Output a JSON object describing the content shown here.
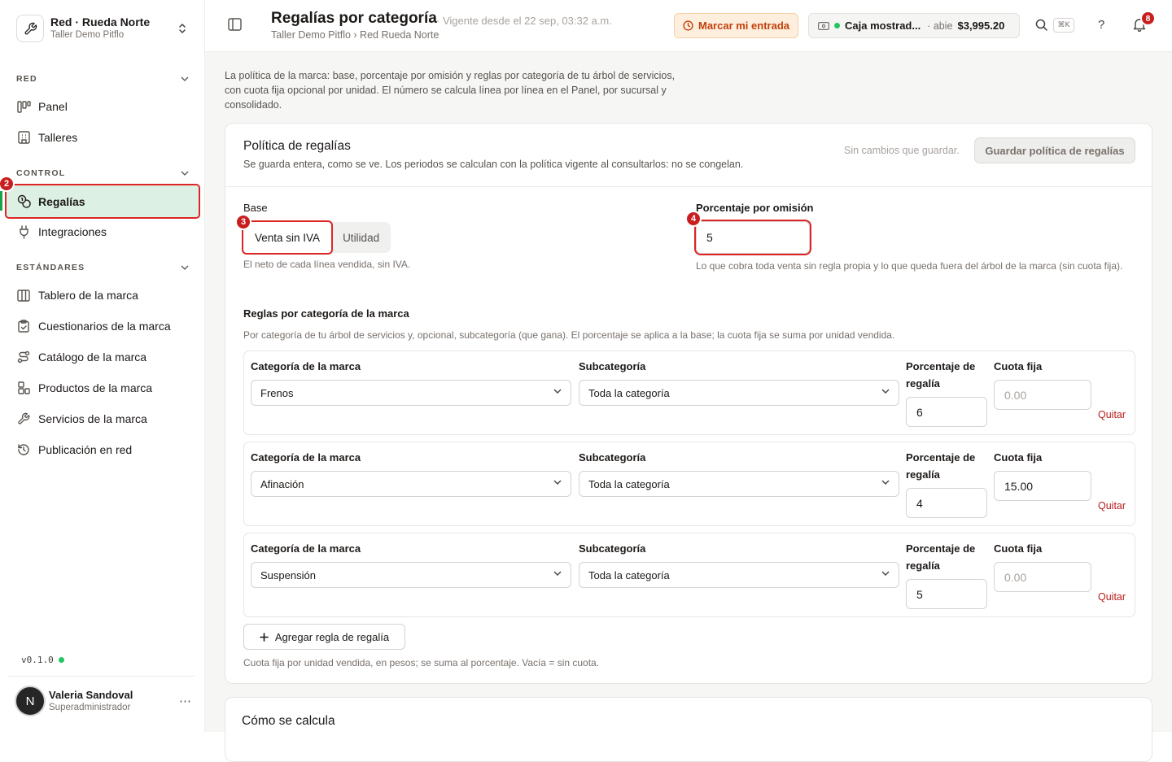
{
  "org": {
    "name": "Red · Rueda Norte",
    "sub": "Taller Demo Pitflo"
  },
  "sidebar": {
    "sections": [
      {
        "title": "RED",
        "items": [
          {
            "label": "Panel"
          },
          {
            "label": "Talleres"
          }
        ]
      },
      {
        "title": "CONTROL",
        "items": [
          {
            "label": "Regalías"
          },
          {
            "label": "Integraciones"
          }
        ]
      },
      {
        "title": "ESTÁNDARES",
        "items": [
          {
            "label": "Tablero de la marca"
          },
          {
            "label": "Cuestionarios de la marca"
          },
          {
            "label": "Catálogo de la marca"
          },
          {
            "label": "Productos de la marca"
          },
          {
            "label": "Servicios de la marca"
          },
          {
            "label": "Publicación en red"
          }
        ]
      }
    ],
    "version": "v0.1.0",
    "user": {
      "initial": "N",
      "name": "Valeria Sandoval",
      "role": "Superadministrador"
    }
  },
  "annotations": {
    "b2": "2",
    "b3": "3",
    "b4": "4"
  },
  "header": {
    "title": "Regalías por categoría",
    "vigencia": "· Vigente desde el 22 sep, 03:32 a.m.",
    "breadcrumb": "Taller Demo Pitflo › Red Rueda Norte",
    "entry_button": "Marcar mi entrada",
    "caja": {
      "name": "Caja mostrad...",
      "status": "· abie",
      "amount": "$3,995.20"
    },
    "kbd": "⌘K",
    "help": "?",
    "notifications": "8"
  },
  "main": {
    "intro": "La política de la marca: base, porcentaje por omisión y reglas por categoría de tu árbol de servicios, con cuota fija opcional por unidad. El número se calcula línea por línea en el Panel, por sucursal y consolidado.",
    "policy": {
      "title": "Política de regalías",
      "subtitle": "Se guarda entera, como se ve. Los periodos se calculan con la política vigente al consultarlos: no se congelan.",
      "no_changes": "Sin cambios que guardar.",
      "save_button": "Guardar política de regalías",
      "base_label": "Base",
      "base_options": [
        "Venta sin IVA",
        "Utilidad"
      ],
      "base_selected": "Venta sin IVA",
      "base_hint": "El neto de cada línea vendida, sin IVA.",
      "default_label": "Porcentaje por omisión",
      "default_value": "5",
      "default_hint": "Lo que cobra toda venta sin regla propia y lo que queda fuera del árbol de la marca (sin cuota fija).",
      "rules_title": "Reglas por categoría de la marca",
      "rules_subtitle": "Por categoría de tu árbol de servicios y, opcional, subcategoría (que gana). El porcentaje se aplica a la base; la cuota fija se suma por unidad vendida.",
      "col_category": "Categoría de la marca",
      "col_subcategory": "Subcategoría",
      "col_percent": "Porcentaje de regalía",
      "col_fee": "Cuota fija",
      "fee_placeholder": "0.00",
      "remove_label": "Quitar",
      "rules": [
        {
          "category": "Frenos",
          "subcategory": "Toda la categoría",
          "percent": "6",
          "fee": ""
        },
        {
          "category": "Afinación",
          "subcategory": "Toda la categoría",
          "percent": "4",
          "fee": "15.00"
        },
        {
          "category": "Suspensión",
          "subcategory": "Toda la categoría",
          "percent": "5",
          "fee": ""
        }
      ],
      "add_rule": "Agregar regla de regalía",
      "footnote": "Cuota fija por unidad vendida, en pesos; se suma al porcentaje. Vacía = sin cuota."
    },
    "calc_title": "Cómo se calcula"
  },
  "colors": {
    "accent": "#16a34a",
    "active_bg": "#dcf0e4",
    "highlight": "#dc2626",
    "warning": "#c2410c",
    "danger": "#b91c1c"
  }
}
